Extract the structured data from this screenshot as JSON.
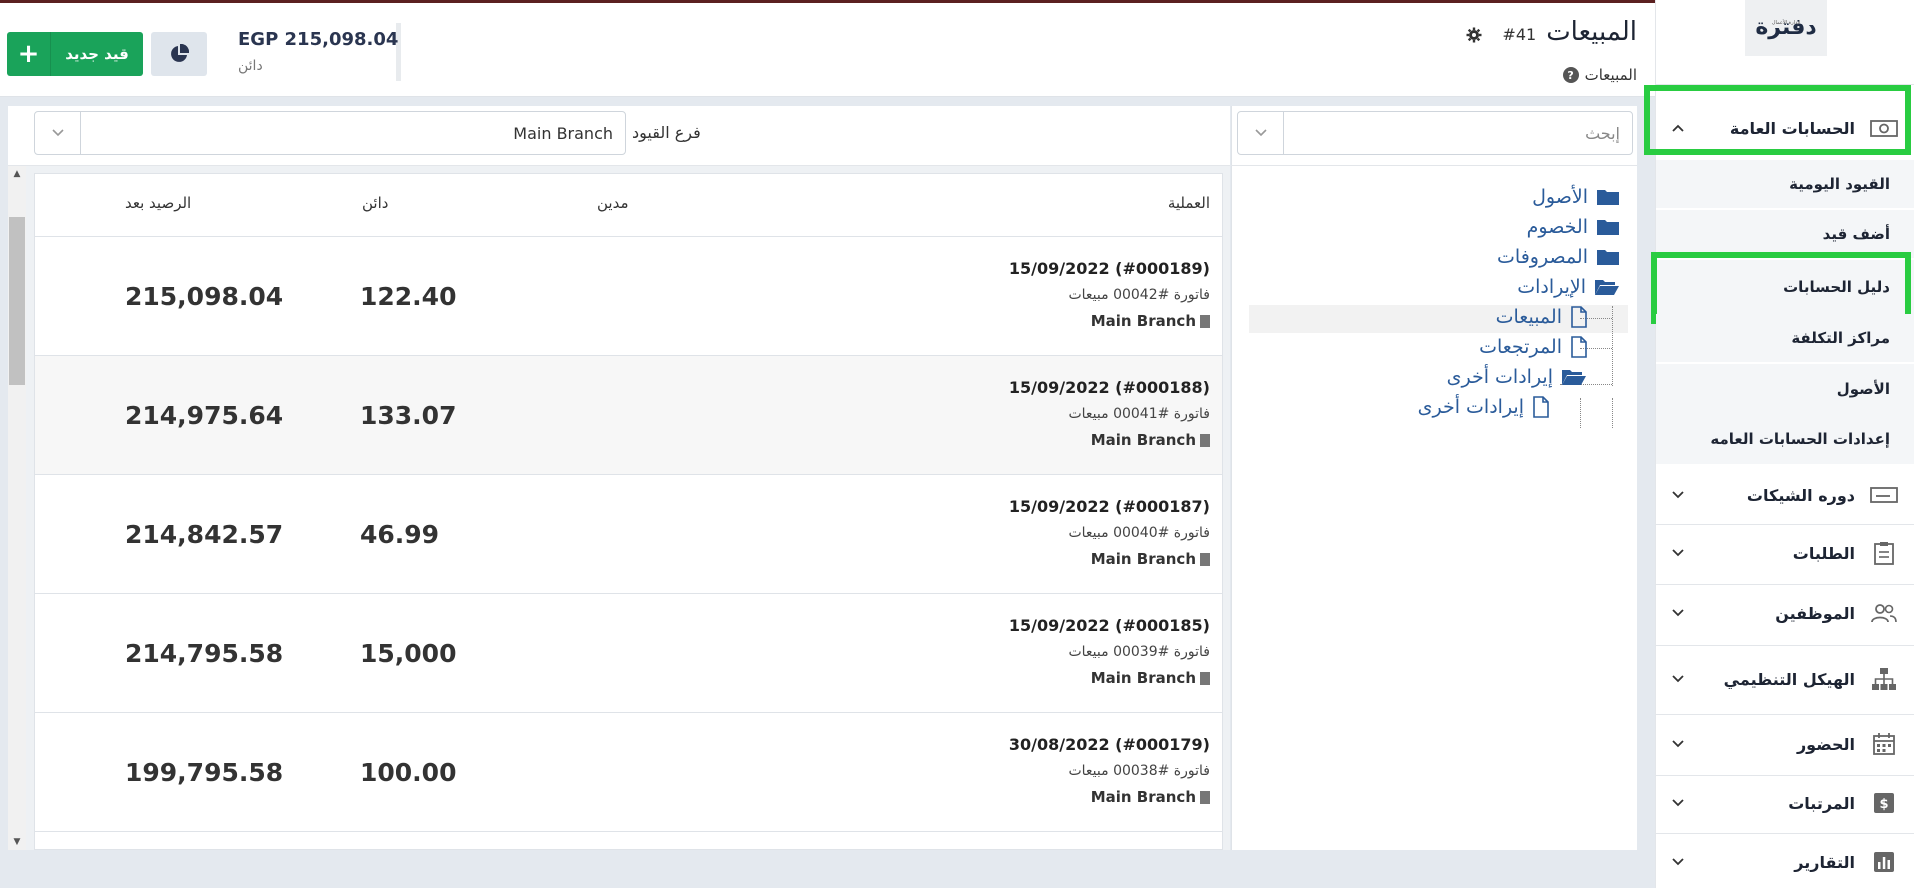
{
  "sidebar": {
    "logo_text": "دفترة",
    "logo_sub": "لإدارة الأعمال",
    "sections": [
      {
        "label": "الحسابات العامة",
        "icon": "money-icon",
        "expanded": true
      },
      {
        "label": "دوره الشيكات",
        "icon": "check-icon"
      },
      {
        "label": "الطلبات",
        "icon": "clipboard-icon"
      },
      {
        "label": "الموظفين",
        "icon": "users-icon"
      },
      {
        "label": "الهيكل التنظيمي",
        "icon": "org-chart-icon"
      },
      {
        "label": "الحضور",
        "icon": "calendar-icon"
      },
      {
        "label": "المرتبات",
        "icon": "dollar-icon"
      },
      {
        "label": "التقارير",
        "icon": "bar-chart-icon"
      }
    ],
    "subitems": [
      "القيود اليومية",
      "أضف قيد",
      "دليل الحسابات",
      "مراكز التكلفة",
      "الأصول",
      "إعدادات الحسابات العامه"
    ],
    "highlight_color": "#29cc41"
  },
  "header": {
    "title": "المبيعات",
    "title_num": "#41",
    "breadcrumb": "المبيعات",
    "balance_amount": "EGP 215,098.04",
    "balance_label": "دائن",
    "new_button": "قيد جديد",
    "new_button_color": "#1aa35a"
  },
  "filters": {
    "search_placeholder": "إبحث",
    "branch_label": "فرع القيود",
    "branch_value": "Main Branch"
  },
  "table": {
    "headers": {
      "operation": "العملية",
      "debit": "مدين",
      "credit": "دائن",
      "balance_after": "الرصيد بعد"
    },
    "rows": [
      {
        "title": "15/09/2022 (#000189)",
        "desc": "فاتورة #00042 مبيعات",
        "branch": "Main Branch",
        "credit": "122.40",
        "balance": "215,098.04"
      },
      {
        "title": "15/09/2022 (#000188)",
        "desc": "فاتورة #00041 مبيعات",
        "branch": "Main Branch",
        "credit": "133.07",
        "balance": "214,975.64"
      },
      {
        "title": "15/09/2022 (#000187)",
        "desc": "فاتورة #00040 مبيعات",
        "branch": "Main Branch",
        "credit": "46.99",
        "balance": "214,842.57"
      },
      {
        "title": "15/09/2022 (#000185)",
        "desc": "فاتورة #00039 مبيعات",
        "branch": "Main Branch",
        "credit": "15,000",
        "balance": "214,795.58"
      },
      {
        "title": "30/08/2022 (#000179)",
        "desc": "فاتورة #00038 مبيعات",
        "branch": "Main Branch",
        "credit": "100.00",
        "balance": "199,795.58"
      }
    ]
  },
  "tree": {
    "nodes": [
      {
        "label": "الأصول",
        "icon": "folder-icon"
      },
      {
        "label": "الخصوم",
        "icon": "folder-icon"
      },
      {
        "label": "المصروفات",
        "icon": "folder-icon"
      },
      {
        "label": "الإيرادات",
        "icon": "folder-open-icon"
      },
      {
        "label": "المبيعات",
        "icon": "file-icon",
        "selected": true
      },
      {
        "label": "المرتجعات",
        "icon": "file-icon"
      },
      {
        "label": "إيرادات أخرى",
        "icon": "folder-open-icon"
      },
      {
        "label": "إيرادات أخرى",
        "icon": "file-icon"
      }
    ],
    "color": "#2a5b9a"
  }
}
